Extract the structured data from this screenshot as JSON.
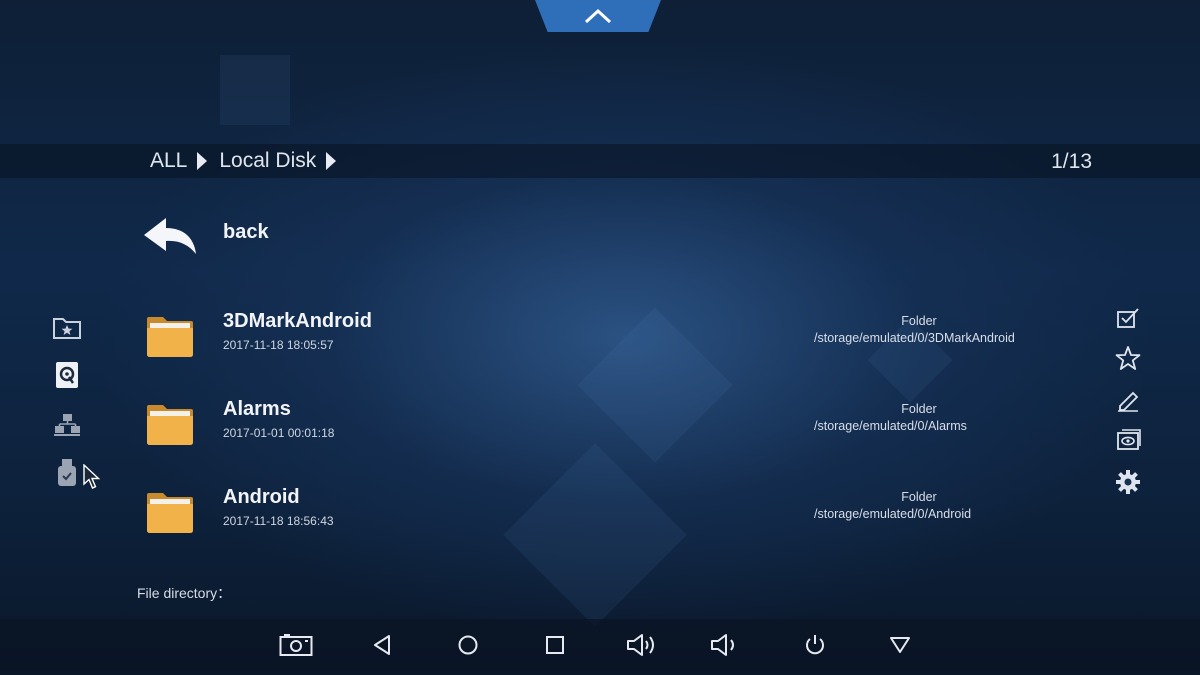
{
  "breadcrumb": {
    "root": "ALL",
    "current": "Local Disk"
  },
  "page_indicator": "1/13",
  "back_label": "back",
  "files": [
    {
      "name": "3DMarkAndroid",
      "date": "2017-11-18 18:05:57",
      "type": "Folder",
      "path": "/storage/emulated/0/3DMarkAndroid"
    },
    {
      "name": "Alarms",
      "date": "2017-01-01 00:01:18",
      "type": "Folder",
      "path": "/storage/emulated/0/Alarms"
    },
    {
      "name": "Android",
      "date": "2017-11-18 18:56:43",
      "type": "Folder",
      "path": "/storage/emulated/0/Android"
    }
  ],
  "footer_label": "File directory：",
  "icons": {
    "left_toolbar": [
      "favorites-folder-icon",
      "local-disk-icon",
      "network-icon",
      "usb-drive-icon"
    ],
    "right_toolbar": [
      "multi-select-icon",
      "star-icon",
      "edit-icon",
      "preview-icon",
      "settings-gear-icon"
    ],
    "nav_bar": [
      "screenshot-icon",
      "back-icon",
      "home-icon",
      "recents-icon",
      "volume-up-icon",
      "volume-down-icon",
      "power-icon",
      "hide-bar-icon"
    ]
  },
  "colors": {
    "accent": "#2f6eb8",
    "folder": "#f1b24a"
  }
}
